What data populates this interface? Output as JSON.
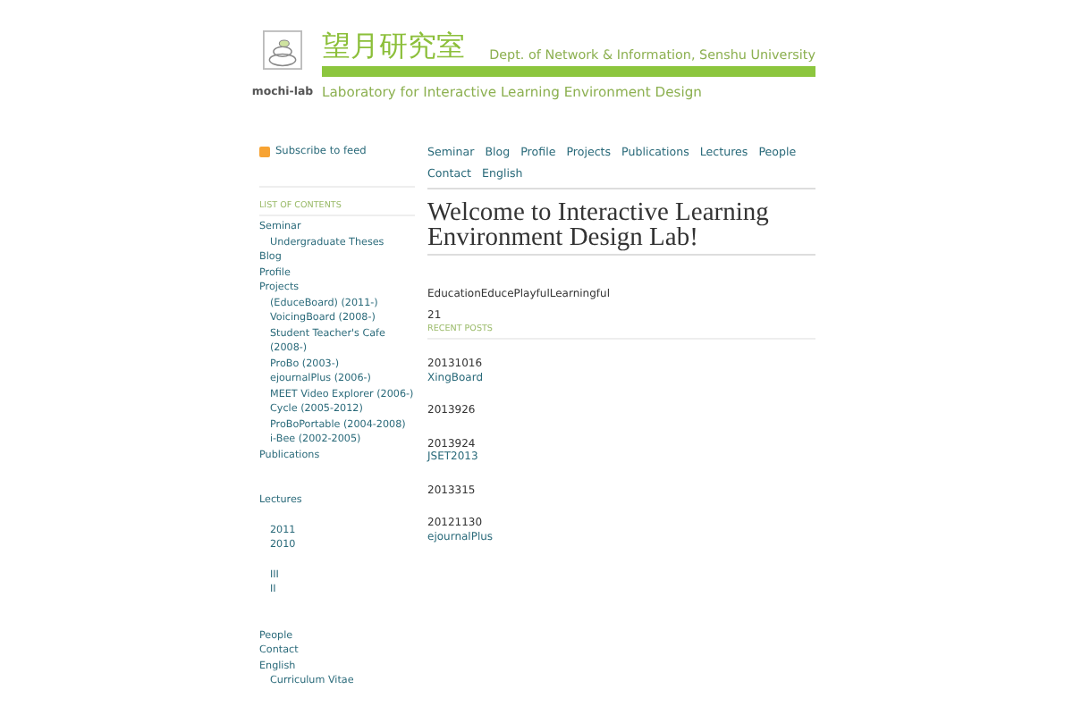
{
  "header": {
    "logo_caption": "mochi-lab",
    "title_ja": "望月研究室",
    "affiliation": "Dept. of Network & Information, Senshu University",
    "subtitle": "Laboratory for Interactive Learning Environment Design"
  },
  "feed": {
    "label": "Subscribe to feed"
  },
  "nav": [
    "Seminar",
    "Blog",
    "Profile",
    "Projects",
    "Publications",
    "Lectures",
    "People",
    "Contact",
    "English"
  ],
  "toc": {
    "heading": "LIST OF CONTENTS",
    "sections": [
      {
        "items": [
          {
            "label": "Seminar",
            "children": [
              {
                "label": "Undergraduate Theses"
              }
            ]
          },
          {
            "label": "Blog"
          },
          {
            "label": "Profile"
          },
          {
            "label": "Projects",
            "children": [
              {
                "label": " (EduceBoard) (2011-)"
              },
              {
                "label": "VoicingBoard (2008-)"
              },
              {
                "label": "Student Teacher's Cafe (2008-)"
              },
              {
                "label": "ProBo (2003-)"
              },
              {
                "label": "ejournalPlus (2006-)"
              },
              {
                "label": "MEET Video Explorer (2006-)"
              },
              {
                "label": "Cycle (2005-2012)"
              },
              {
                "label": "ProBoPortable (2004-2008)"
              },
              {
                "label": "i-Bee (2002-2005)"
              }
            ]
          },
          {
            "label": "Publications"
          }
        ]
      },
      {
        "items": [
          {
            "label": "Lectures",
            "child_groups": [
              [
                {
                  "label": "2011"
                },
                {
                  "label": "2010"
                }
              ],
              [
                {
                  "label": "III"
                },
                {
                  "label": "II"
                }
              ]
            ]
          }
        ]
      },
      {
        "items": [
          {
            "label": "People"
          },
          {
            "label": "Contact"
          },
          {
            "label": "English",
            "children": [
              {
                "label": "Curriculum Vitae"
              }
            ]
          }
        ]
      }
    ]
  },
  "page_title": "Welcome to Interactive Learning Environment Design Lab!",
  "intro": "EducationEducePlayfulLearningful",
  "line_2": "21",
  "recent_heading": "RECENT POSTS",
  "posts": [
    {
      "date": "20131016",
      "link": "XingBoard"
    },
    {
      "date": "2013926"
    },
    {
      "date": "2013924",
      "link": "JSET2013"
    },
    {
      "date": "2013315"
    },
    {
      "date": "20121130",
      "link": "ejournalPlus"
    }
  ]
}
